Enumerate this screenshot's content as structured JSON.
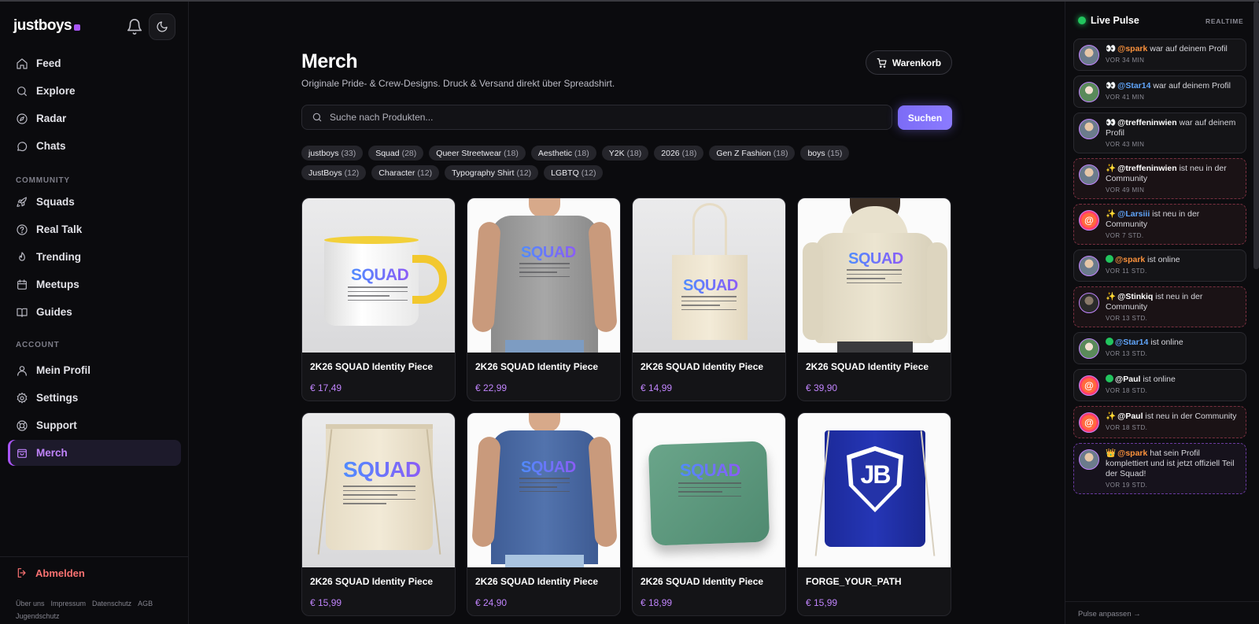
{
  "brand": {
    "name": "justboys"
  },
  "nav": {
    "main": [
      {
        "label": "Feed",
        "icon": "home-icon"
      },
      {
        "label": "Explore",
        "icon": "search-icon"
      },
      {
        "label": "Radar",
        "icon": "compass-icon"
      },
      {
        "label": "Chats",
        "icon": "chat-icon"
      }
    ],
    "community_label": "COMMUNITY",
    "community": [
      {
        "label": "Squads",
        "icon": "rocket-icon"
      },
      {
        "label": "Real Talk",
        "icon": "question-icon"
      },
      {
        "label": "Trending",
        "icon": "flame-icon"
      },
      {
        "label": "Meetups",
        "icon": "calendar-icon"
      },
      {
        "label": "Guides",
        "icon": "book-icon"
      }
    ],
    "account_label": "ACCOUNT",
    "account": [
      {
        "label": "Mein Profil",
        "icon": "user-icon"
      },
      {
        "label": "Settings",
        "icon": "gear-icon"
      },
      {
        "label": "Support",
        "icon": "lifebuoy-icon"
      },
      {
        "label": "Merch",
        "icon": "shopping-bag-icon",
        "active": true
      }
    ],
    "logout": "Abmelden",
    "footer": [
      "Über uns",
      "Impressum",
      "Datenschutz",
      "AGB",
      "Jugendschutz"
    ]
  },
  "main": {
    "title": "Merch",
    "subtitle": "Originale Pride- & Crew-Designs. Druck & Versand direkt über Spreadshirt.",
    "cart_label": "Warenkorb",
    "search_placeholder": "Suche nach Produkten...",
    "search_button": "Suchen",
    "chips": [
      {
        "label": "justboys",
        "count": "(33)"
      },
      {
        "label": "Squad",
        "count": "(28)"
      },
      {
        "label": "Queer Streetwear",
        "count": "(18)"
      },
      {
        "label": "Aesthetic",
        "count": "(18)"
      },
      {
        "label": "Y2K",
        "count": "(18)"
      },
      {
        "label": "2026",
        "count": "(18)"
      },
      {
        "label": "Gen Z Fashion",
        "count": "(18)"
      },
      {
        "label": "boys",
        "count": "(15)"
      },
      {
        "label": "JustBoys",
        "count": "(12)"
      },
      {
        "label": "Character",
        "count": "(12)"
      },
      {
        "label": "Typography Shirt",
        "count": "(12)"
      },
      {
        "label": "LGBTQ",
        "count": "(12)"
      }
    ],
    "products": [
      {
        "name": "2K26 SQUAD Identity Piece",
        "price": "€ 17,49",
        "kind": "mug"
      },
      {
        "name": "2K26 SQUAD Identity Piece",
        "price": "€ 22,99",
        "kind": "tshirt-grey"
      },
      {
        "name": "2K26 SQUAD Identity Piece",
        "price": "€ 14,99",
        "kind": "tote"
      },
      {
        "name": "2K26 SQUAD Identity Piece",
        "price": "€ 39,90",
        "kind": "hoodie"
      },
      {
        "name": "2K26 SQUAD Identity Piece",
        "price": "€ 15,99",
        "kind": "gymbag"
      },
      {
        "name": "2K26 SQUAD Identity Piece",
        "price": "€ 24,90",
        "kind": "tshirt-blue"
      },
      {
        "name": "2K26 SQUAD Identity Piece",
        "price": "€ 18,99",
        "kind": "pillow"
      },
      {
        "name": "FORGE_YOUR_PATH",
        "price": "€ 15,99",
        "kind": "jb-bag"
      }
    ],
    "print_word": "SQUAD",
    "jb_logo": "JB"
  },
  "pulse": {
    "title": "Live Pulse",
    "badge": "REALTIME",
    "items": [
      {
        "emoji": "👀",
        "user": "@spark",
        "ucolor": "or",
        "text": " war auf deinem Profil",
        "time": "VOR 34 MIN",
        "style": "",
        "avatar": "av-photo"
      },
      {
        "emoji": "👀",
        "user": "@Star14",
        "ucolor": "bl",
        "text": " war auf deinem Profil",
        "time": "VOR 41 MIN",
        "style": "",
        "avatar": "av-star"
      },
      {
        "emoji": "👀",
        "user": "@treffeninwien",
        "ucolor": "wh",
        "text": " war auf deinem Profil",
        "time": "VOR 43 MIN",
        "style": "",
        "avatar": "av-photo"
      },
      {
        "emoji": "✨",
        "user": "@treffeninwien",
        "ucolor": "wh",
        "text": " ist neu in der Community",
        "time": "VOR 49 MIN",
        "style": "new",
        "avatar": "av-photo"
      },
      {
        "emoji": "✨",
        "user": "@Larsiii",
        "ucolor": "bl",
        "text": " ist neu in der Community",
        "time": "VOR 7 STD.",
        "style": "new",
        "avatar": "av-orange"
      },
      {
        "emoji": "dot",
        "user": "@spark",
        "ucolor": "or",
        "text": " ist online",
        "time": "VOR 11 STD.",
        "style": "",
        "avatar": "av-photo"
      },
      {
        "emoji": "✨",
        "user": "@Stinkiq",
        "ucolor": "wh",
        "text": " ist neu in der Community",
        "time": "VOR 13 STD.",
        "style": "new",
        "avatar": "av-dark"
      },
      {
        "emoji": "dot",
        "user": "@Star14",
        "ucolor": "bl",
        "text": " ist online",
        "time": "VOR 13 STD.",
        "style": "",
        "avatar": "av-star"
      },
      {
        "emoji": "dot",
        "user": "@Paul",
        "ucolor": "wh",
        "text": " ist online",
        "time": "VOR 18 STD.",
        "style": "",
        "avatar": "av-orange"
      },
      {
        "emoji": "✨",
        "user": "@Paul",
        "ucolor": "wh",
        "text": " ist neu in der Community",
        "time": "VOR 18 STD.",
        "style": "new",
        "avatar": "av-orange"
      },
      {
        "emoji": "👑",
        "user": "@spark",
        "ucolor": "or",
        "text": " hat sein Profil komplettiert und ist jetzt offiziell Teil der Squad!",
        "time": "VOR 19 STD.",
        "style": "crown",
        "avatar": "av-photo"
      }
    ],
    "footer": "Pulse anpassen →"
  },
  "colors": {
    "accent": "#a855f7",
    "price": "#c084fc",
    "online": "#22c55e",
    "button": "#7c6cf6"
  }
}
